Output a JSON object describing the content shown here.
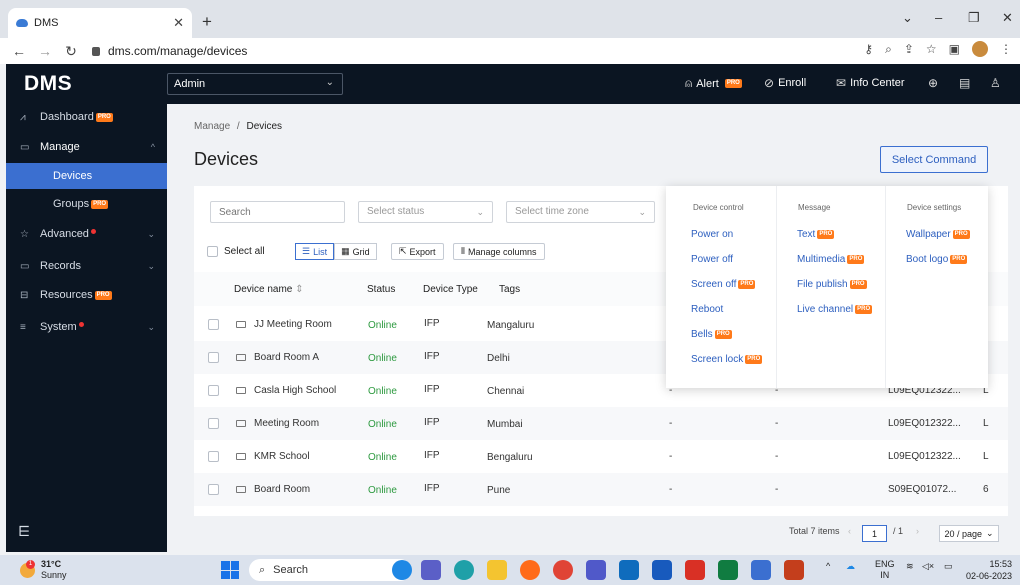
{
  "browser": {
    "tab_title": "DMS",
    "url": "dms.com/manage/devices"
  },
  "app": {
    "logo": "DMS",
    "tenant": "Admin",
    "header": {
      "alert": "Alert",
      "enroll": "Enroll",
      "info_center": "Info Center"
    }
  },
  "sidebar": {
    "dashboard": "Dashboard",
    "manage": "Manage",
    "devices": "Devices",
    "groups": "Groups",
    "advanced": "Advanced",
    "records": "Records",
    "resources": "Resources",
    "system": "System"
  },
  "pro_badge": "PRO",
  "main": {
    "breadcrumb_root": "Manage",
    "breadcrumb_sep": "/",
    "breadcrumb_current": "Devices",
    "title": "Devices",
    "select_command": "Select Command",
    "filters": {
      "search_placeholder": "Search",
      "status_placeholder": "Select status",
      "time_placeholder": "Select time zone"
    },
    "toolbar": {
      "select_all": "Select all",
      "list": "List",
      "grid": "Grid",
      "export": "Export",
      "manage_columns": "Manage columns"
    },
    "columns": {
      "device_name": "Device name",
      "status": "Status",
      "device_type": "Device Type",
      "tags": "Tags"
    },
    "rows": [
      {
        "name": "JJ Meeting Room",
        "status": "Online",
        "type": "IFP",
        "tag": "Mangaluru",
        "c5": "",
        "c6": "",
        "serial": "",
        "tail": ""
      },
      {
        "name": "Board Room A",
        "status": "Online",
        "type": "IFP",
        "tag": "Delhi",
        "c5": "",
        "c6": "",
        "serial": "",
        "tail": ""
      },
      {
        "name": "Casla High School",
        "status": "Online",
        "type": "IFP",
        "tag": "Chennai",
        "c5": "-",
        "c6": "-",
        "serial": "L09EQ012322...",
        "tail": "L"
      },
      {
        "name": "Meeting Room",
        "status": "Online",
        "type": "IFP",
        "tag": "Mumbai",
        "c5": "-",
        "c6": "-",
        "serial": "L09EQ012322...",
        "tail": "L"
      },
      {
        "name": "KMR School",
        "status": "Online",
        "type": "IFP",
        "tag": "Bengaluru",
        "c5": "-",
        "c6": "-",
        "serial": "L09EQ012322...",
        "tail": "L"
      },
      {
        "name": "Board Room",
        "status": "Online",
        "type": "IFP",
        "tag": "Pune",
        "c5": "-",
        "c6": "-",
        "serial": "S09EQ01072...",
        "tail": "6"
      }
    ],
    "pagination": {
      "total": "Total 7 items",
      "page": "1",
      "of": "/ 1",
      "per_page": "20 / page"
    }
  },
  "command_menu": {
    "device_control": {
      "heading": "Device control",
      "items": [
        "Power on",
        "Power off",
        "Screen off",
        "Reboot",
        "Bells",
        "Screen lock"
      ]
    },
    "message": {
      "heading": "Message",
      "items": [
        "Text",
        "Multimedia",
        "File publish",
        "Live channel"
      ]
    },
    "device_settings": {
      "heading": "Device settings",
      "items": [
        "Wallpaper",
        "Boot logo"
      ]
    }
  },
  "taskbar": {
    "temp": "31°C",
    "weather": "Sunny",
    "weather_badge": "1",
    "search": "Search",
    "lang1": "ENG",
    "lang2": "IN",
    "time": "15:53",
    "date": "02-06-2023"
  },
  "colors": {
    "nav_bg": "#0b1522",
    "accent": "#3b6fd0",
    "online": "#2e9a40",
    "pro_badge": "#ff7a1a"
  }
}
